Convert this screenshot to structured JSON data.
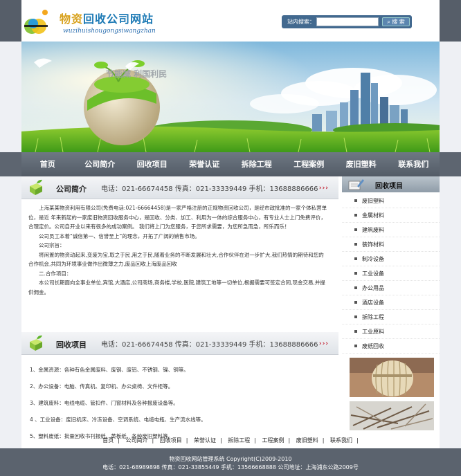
{
  "header": {
    "site_title_a": "物资",
    "site_title_b": "回收公司网站",
    "site_subtitle": "wuzihuishougongsiwangzhan",
    "search_label": "站内搜索：",
    "search_value": "",
    "search_button": "搜 索"
  },
  "banner": {
    "slogan": "节能减 利国利民"
  },
  "nav": {
    "items": [
      "首页",
      "公司简介",
      "回收项目",
      "荣誉认证",
      "拆除工程",
      "工程案例",
      "废旧塑料",
      "联系我们"
    ]
  },
  "contact_line": "电话：021-66674458 传真：021-33339449 手机：13688886666",
  "more_mark": "›››",
  "intro_section": {
    "title": "公司简介",
    "paragraphs": [
      "上海某某物资利用有限公司(免费电话:021-66664458)是一家严格注册的正规物资回收公司，是经市政批准的一家个体私营单位，是近 年来新起的一家废旧物资回收服务中心，是回收、分类、加工、利用为一体的综合服务中心，有专业人士上门免费评价， 合理定价。公司自开业以来有很多的成功案例。 我们将上门为您服务，于您所求需要，为您所急而急，所乐而乐！",
      "公司员工本着“诚信第一、信誉至上”的理念，开拓了广阔的销售市场。",
      "公司宗旨：",
      "将闲置的物资动起来,变废为宝,取之于民,用之于民,随着业务的不断发展和壮大,合作伙伴在进一步扩大,我们热情的期待和您的合作机会,共同为环境事业做作出微薄之力,废品回收上海废品回收",
      "二.合作项目：",
      "本公司长期面向全事业单位,宾馆,大酒店,公司商场,商务楼,学校,医院,建筑工地等一切单位,根据需要可签定合同,现金交易,并提供佣金。"
    ]
  },
  "recycle_section": {
    "title": "回收项目",
    "items": [
      "1、金属资源：各种有色金属废料、废钢、废铝、不锈钢、镍、铜等。",
      "2、办公设备：电脑、传真机、复印机、办公桌椅、文件柜等。",
      "3、建筑废料：电线电缆、管扣件、门窗材料及各种报废设备等。",
      "4 、工业设备：废旧机床、冷冻设备、空调系统、电缆电瓶、生产流水线等。",
      "5、塑料废纸：批量回收书刊报纸、黄板纸、各种废旧塑料等。"
    ]
  },
  "sidebar": {
    "title": "回收项目",
    "items": [
      "废旧塑料",
      "金属材料",
      "建筑废料",
      "装饰材料",
      "制冷设备",
      "工业设备",
      "办公用品",
      "酒店设备",
      "拆除工程",
      "工业原料",
      "废纸回收"
    ]
  },
  "footer": {
    "links": [
      "首页",
      "公司简介",
      "回收项目",
      "荣誉认证",
      "拆除工程",
      "工程案例",
      "废旧塑料",
      "联系我们"
    ],
    "separator": "|",
    "copyright": "物资回收网站管理系统  Copyright(C)2009-2010",
    "contact": "电话：021-68989898 传真：021-33855449 手机：13566668888 公司地址：上海浦东公路2009号"
  },
  "colors": {
    "nav_bg": "#5d6570",
    "title_gold": "#d8a11c",
    "title_blue": "#1d7ab5",
    "more_red": "#c0182a",
    "search_bg": "#42698f"
  }
}
